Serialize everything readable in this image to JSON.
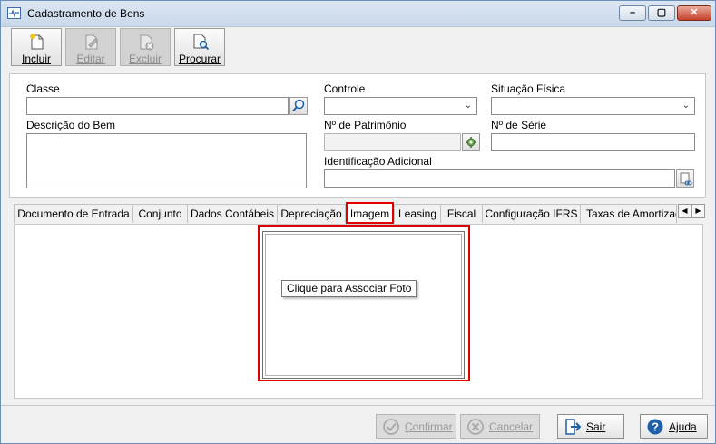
{
  "window": {
    "title": "Cadastramento de Bens"
  },
  "toolbar": {
    "incluir": "Incluir",
    "editar": "Editar",
    "excluir": "Excluir",
    "procurar": "Procurar"
  },
  "form": {
    "classe_label": "Classe",
    "classe_value": "",
    "controle_label": "Controle",
    "controle_value": "",
    "situacao_label": "Situação Física",
    "situacao_value": "",
    "descricao_label": "Descrição do Bem",
    "descricao_value": "",
    "patrimonio_label": "Nº de Patrimônio",
    "patrimonio_value": "",
    "serie_label": "Nº de Série",
    "serie_value": "",
    "identificacao_label": "Identificação Adicional",
    "identificacao_value": ""
  },
  "tabs": [
    {
      "label": "Documento de Entrada"
    },
    {
      "label": "Conjunto"
    },
    {
      "label": "Dados Contábeis"
    },
    {
      "label": "Depreciação"
    },
    {
      "label": "Imagem"
    },
    {
      "label": "Leasing"
    },
    {
      "label": "Fiscal"
    },
    {
      "label": "Configuração IFRS"
    },
    {
      "label": "Taxas de Amortização"
    }
  ],
  "active_tab": "Imagem",
  "image_tab": {
    "tooltip": "Clique para Associar Foto"
  },
  "buttons": {
    "confirmar": "Confirmar",
    "cancelar": "Cancelar",
    "sair": "Sair",
    "ajuda": "Ajuda"
  },
  "colors": {
    "highlight": "#e00000",
    "title_bar": "#dbe6f3"
  }
}
